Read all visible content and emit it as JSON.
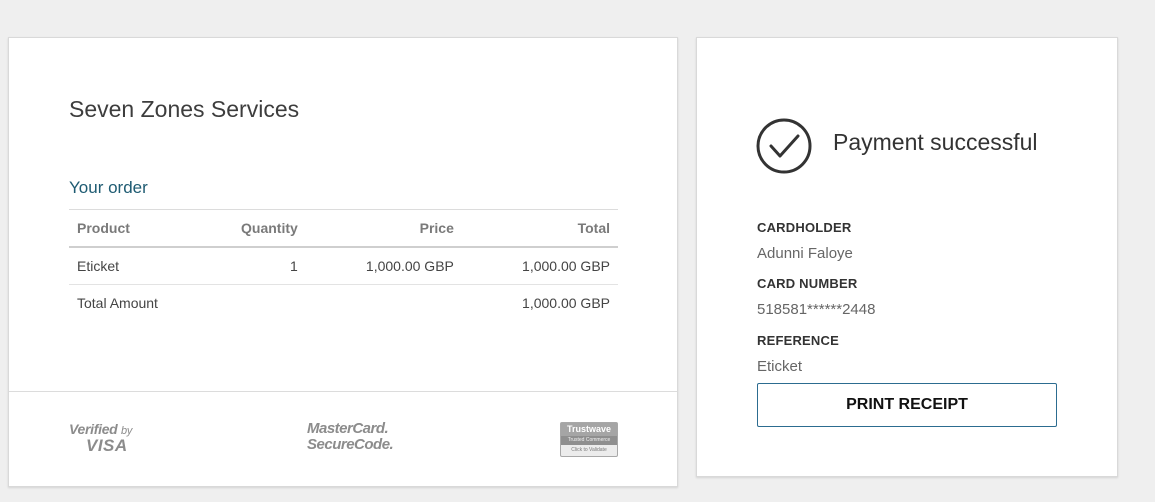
{
  "order": {
    "merchant_name": "Seven Zones Services",
    "heading": "Your order",
    "columns": {
      "product": "Product",
      "quantity": "Quantity",
      "price": "Price",
      "total": "Total"
    },
    "items": [
      {
        "product": "Eticket",
        "quantity": "1",
        "price": "1,000.00 GBP",
        "total": "1,000.00 GBP"
      }
    ],
    "total_label": "Total Amount",
    "total_value": "1,000.00 GBP"
  },
  "security_logos": {
    "visa_line1": "Verified",
    "visa_by": "by",
    "visa_line2": "VISA",
    "mastercard_line1": "MasterCard.",
    "mastercard_line2": "SecureCode.",
    "trustwave_line1": "Trustwave",
    "trustwave_line2": "Trusted Commerce",
    "trustwave_line3": "Click to Validate"
  },
  "payment": {
    "status_icon": "check-circle-icon",
    "status_text": "Payment successful",
    "cardholder_label": "CARDHOLDER",
    "cardholder_value": "Adunni Faloye",
    "card_number_label": "CARD NUMBER",
    "card_number_value": "518581******2448",
    "reference_label": "REFERENCE",
    "reference_value": "Eticket",
    "print_button_label": "PRINT RECEIPT"
  },
  "colors": {
    "page_background": "#efefef",
    "order_heading": "#1e5b72",
    "button_border": "#2c6c90"
  }
}
